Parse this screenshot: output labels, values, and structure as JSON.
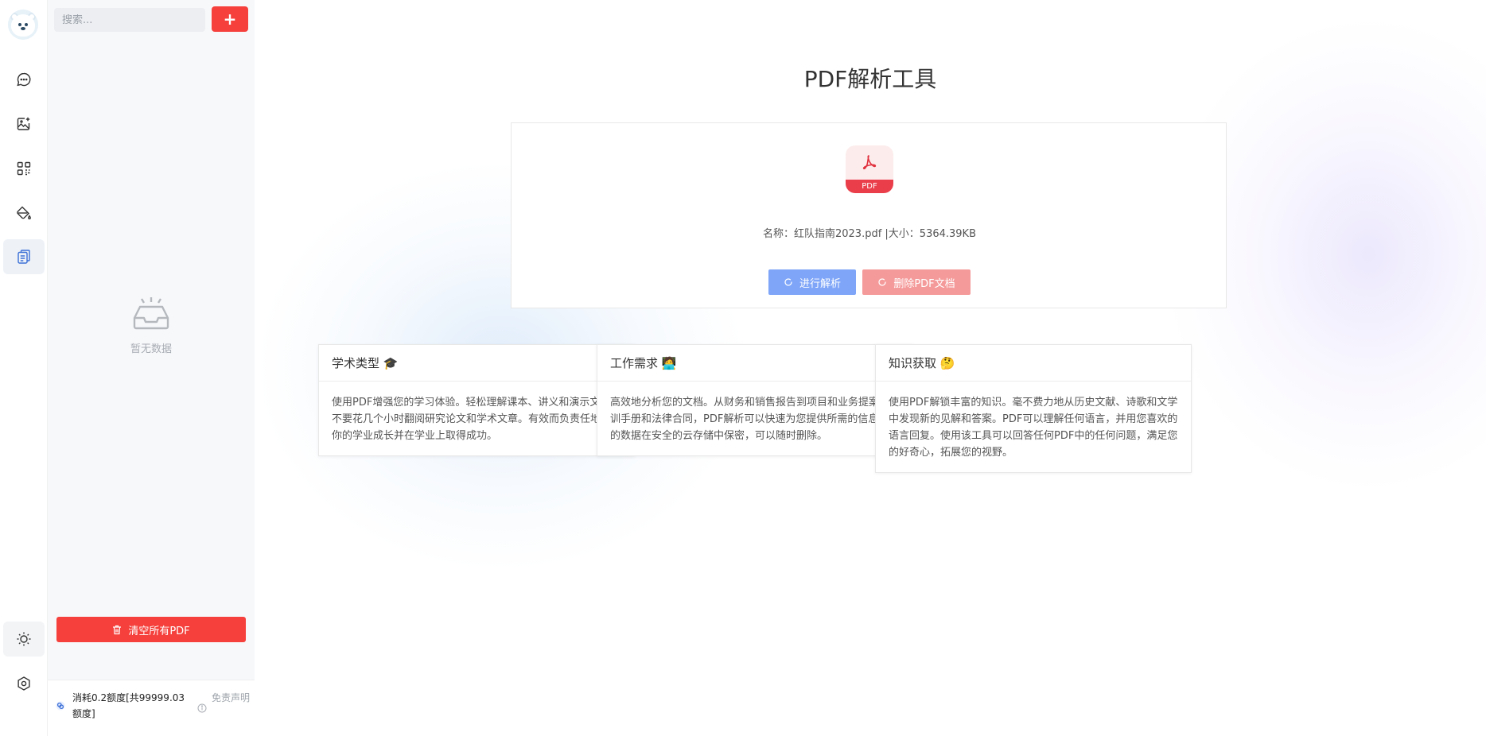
{
  "rail": {
    "items": [
      {
        "name": "chat-icon"
      },
      {
        "name": "image-icon"
      },
      {
        "name": "apps-icon"
      },
      {
        "name": "paint-icon"
      },
      {
        "name": "document-icon",
        "active": true
      }
    ],
    "bottom": [
      {
        "name": "sun-icon"
      },
      {
        "name": "settings-icon"
      }
    ]
  },
  "sidebar": {
    "search_placeholder": "搜索...",
    "add_label": "+",
    "empty_text": "暂无数据",
    "clear_label": "清空所有PDF",
    "usage_text": "消耗0.2额度[共99999.03额度]",
    "disclaimer": "免责声明"
  },
  "main": {
    "title": "PDF解析工具",
    "pdf_badge": "PDF",
    "file_info": "名称：红队指南2023.pdf |大小：5364.39KB",
    "parse_label": "进行解析",
    "delete_label": "删除PDF文档"
  },
  "features": [
    {
      "title": "学术类型 🎓",
      "body": "使用PDF增强您的学习体验。轻松理解课本、讲义和演示文稿。不要花几个小时翻阅研究论文和学术文章。有效而负责任地支持你的学业成长并在学业上取得成功。"
    },
    {
      "title": "工作需求 🧑‍💻",
      "body": "高效地分析您的文档。从财务和销售报告到项目和业务提案、培训手册和法律合同，PDF解析可以快速为您提供所需的信息。您的数据在安全的云存储中保密，可以随时删除。"
    },
    {
      "title": "知识获取 🤔",
      "body": "使用PDF解锁丰富的知识。毫不费力地从历史文献、诗歌和文学中发现新的见解和答案。PDF可以理解任何语言，并用您喜欢的语言回复。使用该工具可以回答任何PDF中的任何问题，满足您的好奇心，拓展您的视野。"
    }
  ],
  "colors": {
    "accent_red": "#f5403b",
    "parse_blue": "#7ea5f8",
    "delete_pink": "#f59a9a",
    "pdf_red": "#ea3f4b",
    "active_icon_blue": "#3b6fd6"
  }
}
